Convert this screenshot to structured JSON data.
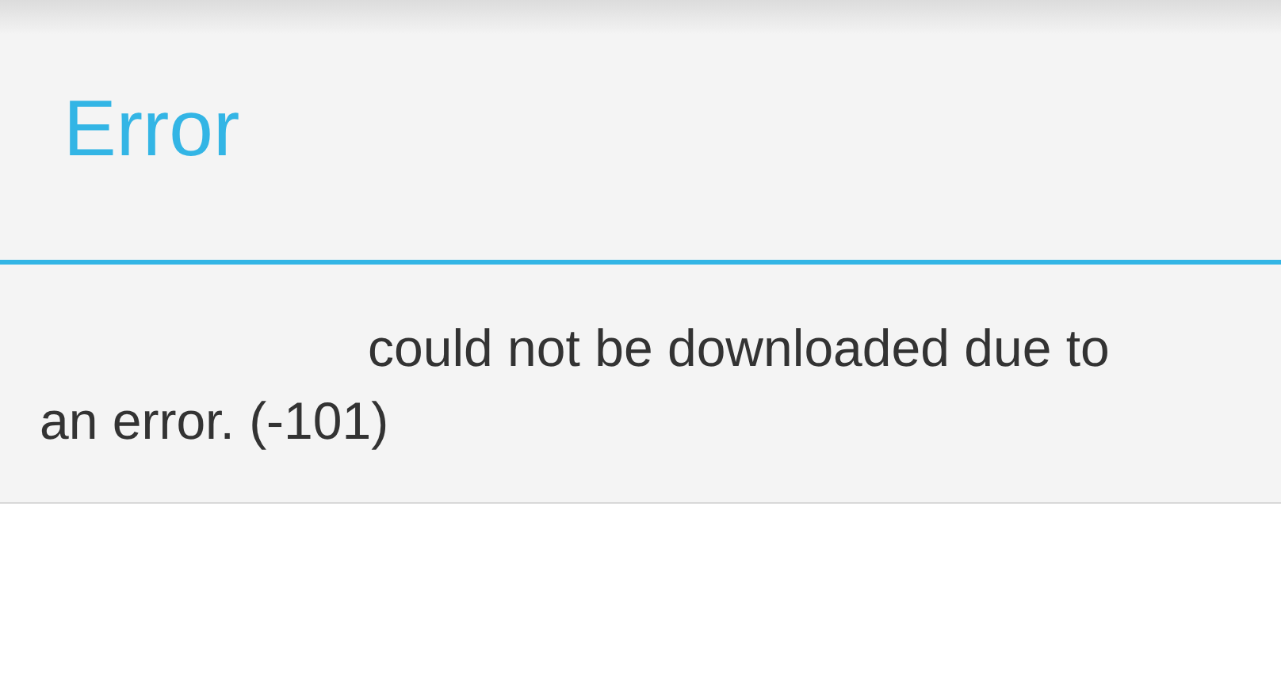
{
  "dialog": {
    "title": "Error",
    "message": "could not be downloaded due to an error. (-101)"
  }
}
